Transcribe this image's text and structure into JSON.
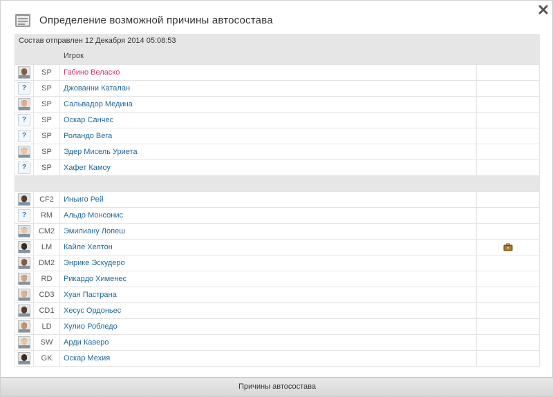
{
  "header": {
    "title": "Определение возможной причины автосостава"
  },
  "sent_line": "Состав отправлен 12 Декабря 2014 05:08:53",
  "table_header": {
    "player": "Игрок"
  },
  "starters": [
    {
      "pos": "SP",
      "name": "Габино Веласко",
      "avatar": "photo",
      "highlight": true
    },
    {
      "pos": "SP",
      "name": "Джованни Каталан",
      "avatar": "unknown"
    },
    {
      "pos": "SP",
      "name": "Сальвадор Медина",
      "avatar": "photo"
    },
    {
      "pos": "SP",
      "name": "Оскар Санчес",
      "avatar": "unknown"
    },
    {
      "pos": "SP",
      "name": "Роландо Вега",
      "avatar": "unknown"
    },
    {
      "pos": "SP",
      "name": "Эдер Мисель Уриета",
      "avatar": "photo"
    },
    {
      "pos": "SP",
      "name": "Хафет Камоу",
      "avatar": "unknown"
    }
  ],
  "lineup": [
    {
      "pos": "CF2",
      "name": "Иньиго Рей",
      "avatar": "photo"
    },
    {
      "pos": "RM",
      "name": "Альдо Монсонис",
      "avatar": "unknown"
    },
    {
      "pos": "CM2",
      "name": "Эмилиану Лопеш",
      "avatar": "photo"
    },
    {
      "pos": "LM",
      "name": "Кайле Хелтон",
      "avatar": "photo",
      "briefcase": true
    },
    {
      "pos": "DM2",
      "name": "Энрике Эскудеро",
      "avatar": "photo"
    },
    {
      "pos": "RD",
      "name": "Рикардо Хименес",
      "avatar": "photo"
    },
    {
      "pos": "CD3",
      "name": "Хуан Пастрана",
      "avatar": "photo"
    },
    {
      "pos": "CD1",
      "name": "Хесус Ордоньес",
      "avatar": "photo"
    },
    {
      "pos": "LD",
      "name": "Хулио Робледо",
      "avatar": "photo"
    },
    {
      "pos": "SW",
      "name": "Арди Каверо",
      "avatar": "photo"
    },
    {
      "pos": "GK",
      "name": "Оскар Мехия",
      "avatar": "photo"
    }
  ],
  "unknown_avatar_glyph": "?",
  "footer": {
    "label": "Причины автосостава"
  },
  "icons": {
    "header": "folder-icon",
    "close": "close-icon",
    "transfer": "briefcase-icon"
  },
  "colors": {
    "link": "#1f6796",
    "highlight": "#d0306f",
    "panel": "#e6e6e6"
  }
}
